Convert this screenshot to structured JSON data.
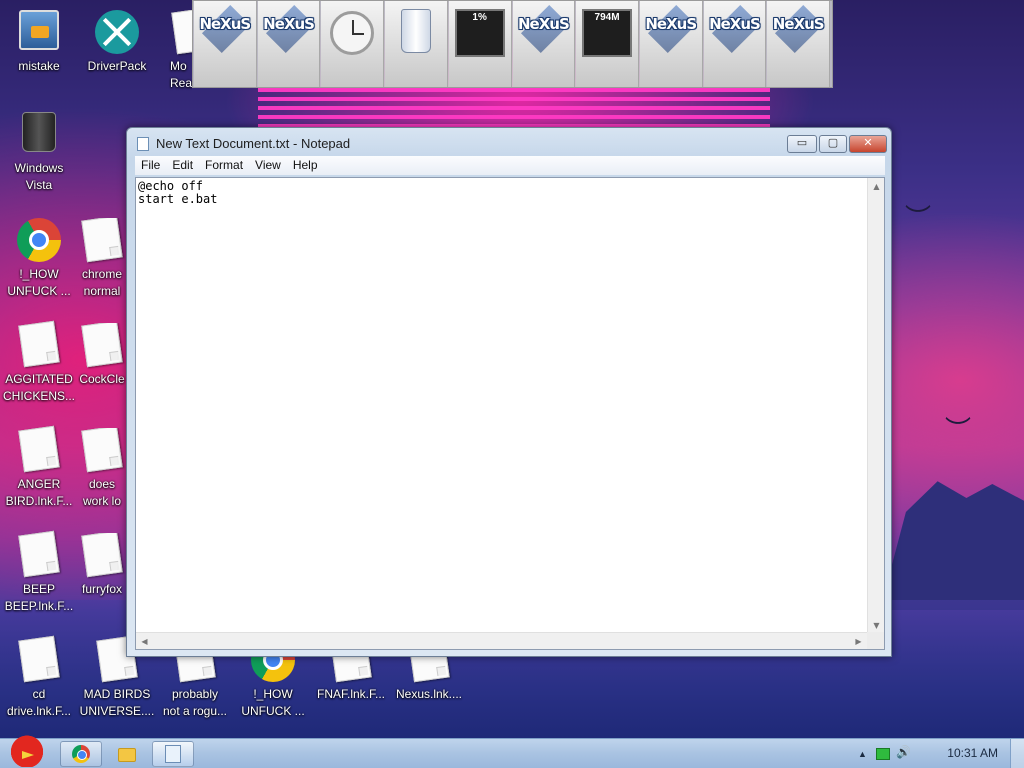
{
  "desktop": {
    "icons": [
      {
        "label": "mistake"
      },
      {
        "label": "DriverPack"
      },
      {
        "label": "Mo\nReade"
      },
      {
        "label": "Windows\nVista"
      },
      {
        "label": "!_HOW\nUNFUCK ..."
      },
      {
        "label": "chrome\nnormal"
      },
      {
        "label": "AGGITATED\nCHICKENS..."
      },
      {
        "label": "CockCle"
      },
      {
        "label": "ANGER\nBIRD.lnk.F..."
      },
      {
        "label": "does\nwork lo"
      },
      {
        "label": "BEEP\nBEEP.lnk.F..."
      },
      {
        "label": "furryfox"
      },
      {
        "label": "cd\ndrive.lnk.F..."
      },
      {
        "label": "MAD BIRDS\nUNIVERSE...."
      },
      {
        "label": "probably\nnot a rogu..."
      },
      {
        "label": "!_HOW\nUNFUCK ..."
      },
      {
        "label": "FNAF.lnk.F..."
      },
      {
        "label": "Nexus.lnk...."
      }
    ]
  },
  "dock": {
    "items": [
      {
        "icon": "nexus-logo",
        "text": "NeXuS"
      },
      {
        "icon": "nexus-logo",
        "text": "NeXuS"
      },
      {
        "icon": "clock-icon",
        "text": ""
      },
      {
        "icon": "recycle-bin-icon",
        "text": ""
      },
      {
        "icon": "cpu-meter-icon",
        "text": "1%"
      },
      {
        "icon": "nexus-logo",
        "text": "NeXuS"
      },
      {
        "icon": "memory-meter-icon",
        "text": "794M"
      },
      {
        "icon": "nexus-logo",
        "text": "NeXuS"
      },
      {
        "icon": "nexus-logo",
        "text": "NeXuS"
      },
      {
        "icon": "nexus-logo",
        "text": "NeXuS"
      }
    ]
  },
  "notepad": {
    "title": "New Text Document.txt - Notepad",
    "controls": {
      "minimize": "▭",
      "maximize": "▢",
      "close": "✕"
    },
    "menu": [
      "File",
      "Edit",
      "Format",
      "View",
      "Help"
    ],
    "content": "@echo off\nstart e.bat"
  },
  "taskbar": {
    "clock": "10:31 AM",
    "tray_arrow": "▲",
    "volume": "🔊",
    "buttons": [
      "chrome",
      "explorer",
      "notepad"
    ]
  },
  "colors": {
    "accent": "#3b2f86",
    "neon": "#ff3ac4",
    "close_button": "#c7452e"
  }
}
